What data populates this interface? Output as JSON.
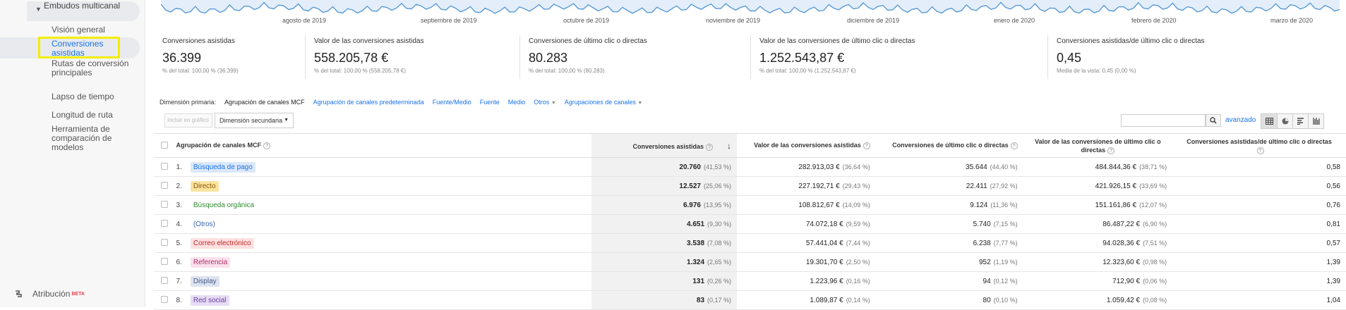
{
  "sidebar": {
    "section_label": "Embudos multicanal",
    "items": [
      {
        "label": "Visión general"
      },
      {
        "label": "Conversiones asistidas"
      },
      {
        "label": "Rutas de conversión principales"
      },
      {
        "label": "Lapso de tiempo"
      },
      {
        "label": "Longitud de ruta"
      },
      {
        "label": "Herramienta de comparación de modelos"
      }
    ],
    "attribution_label": "Atribución",
    "beta_label": "BETA"
  },
  "chart": {
    "months": [
      "agosto de 2019",
      "septiembre de 2019",
      "octubre de 2019",
      "noviembre de 2019",
      "diciembre de 2019",
      "enero de 2020",
      "febrero de 2020",
      "marzo de 2020"
    ],
    "line_color": "#5b9bd5",
    "fill_color": "#e3eefa"
  },
  "summary": [
    {
      "label": "Conversiones asistidas",
      "value": "36.399",
      "sub": "% del total: 100,00 % (36.399)"
    },
    {
      "label": "Valor de las conversiones asistidas",
      "value": "558.205,78 €",
      "sub": "% del total: 100,00 % (558.205,78 €)"
    },
    {
      "label": "Conversiones de último clic o directas",
      "value": "80.283",
      "sub": "% del total: 100,00 % (80.283)"
    },
    {
      "label": "Valor de las conversiones de último clic o directas",
      "value": "1.252.543,87 €",
      "sub": "% del total: 100,00 % (1.252.543,87 €)"
    },
    {
      "label": "Conversiones asistidas/de último clic o directas",
      "value": "0,45",
      "sub": "Media de la vista: 0,45 (0,00 %)"
    }
  ],
  "dimensions": {
    "label": "Dimensión primaria:",
    "active": "Agrupación de canales MCF",
    "links": [
      "Agrupación de canales predeterminada",
      "Fuente/Medio",
      "Fuente",
      "Medio",
      "Otros",
      "Agrupaciones de canales"
    ]
  },
  "toolbar": {
    "plot_label": "Incluir en gráfico",
    "secondary_dimension": "Dimensión secundaria",
    "advanced_label": "avanzado"
  },
  "table": {
    "headers": [
      "Agrupación de canales MCF",
      "Conversiones asistidas",
      "Valor de las conversiones asistidas",
      "Conversiones de último clic o directas",
      "Valor de las conversiones de último clic o directas",
      "Conversiones asistidas/de último clic o directas"
    ],
    "rows": [
      {
        "idx": "1.",
        "channel": "Búsqueda de pago",
        "color": "#1a73e8",
        "bg": "#dce8fb",
        "assisted": "20.760",
        "assisted_pct": "(41,53 %)",
        "assisted_value": "282.913,03 €",
        "assisted_value_pct": "(36,64 %)",
        "last": "35.644",
        "last_pct": "(44,40 %)",
        "last_value": "484.844,36 €",
        "last_value_pct": "(38,71 %)",
        "ratio": "0,58"
      },
      {
        "idx": "2.",
        "channel": "Directo",
        "color": "#8a5a00",
        "bg": "#fbe3a0",
        "assisted": "12.527",
        "assisted_pct": "(25,06 %)",
        "assisted_value": "227.192,71 €",
        "assisted_value_pct": "(29,43 %)",
        "last": "22.411",
        "last_pct": "(27,92 %)",
        "last_value": "421.926,15 €",
        "last_value_pct": "(33,69 %)",
        "ratio": "0,56"
      },
      {
        "idx": "3.",
        "channel": "Búsqueda orgánica",
        "color": "#2e8b2e",
        "bg": "#ffffff",
        "assisted": "6.976",
        "assisted_pct": "(13,95 %)",
        "assisted_value": "108.812,67 €",
        "assisted_value_pct": "(14,09 %)",
        "last": "9.124",
        "last_pct": "(11,36 %)",
        "last_value": "151.161,86 €",
        "last_value_pct": "(12,07 %)",
        "ratio": "0,76"
      },
      {
        "idx": "4.",
        "channel": "(Otros)",
        "color": "#3366aa",
        "bg": "#ffffff",
        "assisted": "4.651",
        "assisted_pct": "(9,30 %)",
        "assisted_value": "74.072,18 €",
        "assisted_value_pct": "(9,59 %)",
        "last": "5.740",
        "last_pct": "(7,15 %)",
        "last_value": "86.487,22 €",
        "last_value_pct": "(6,90 %)",
        "ratio": "0,81"
      },
      {
        "idx": "5.",
        "channel": "Correo electrónico",
        "color": "#c62828",
        "bg": "#fde0e0",
        "assisted": "3.538",
        "assisted_pct": "(7,08 %)",
        "assisted_value": "57.441,04 €",
        "assisted_value_pct": "(7,44 %)",
        "last": "6.238",
        "last_pct": "(7,77 %)",
        "last_value": "94.028,36 €",
        "last_value_pct": "(7,51 %)",
        "ratio": "0,57"
      },
      {
        "idx": "6.",
        "channel": "Referencia",
        "color": "#b0306a",
        "bg": "#fbe0ec",
        "assisted": "1.324",
        "assisted_pct": "(2,65 %)",
        "assisted_value": "19.301,70 €",
        "assisted_value_pct": "(2,50 %)",
        "last": "952",
        "last_pct": "(1,19 %)",
        "last_value": "12.323,60 €",
        "last_value_pct": "(0,98 %)",
        "ratio": "1,39"
      },
      {
        "idx": "7.",
        "channel": "Display",
        "color": "#455a8a",
        "bg": "#dde3ef",
        "assisted": "131",
        "assisted_pct": "(0,26 %)",
        "assisted_value": "1.223,96 €",
        "assisted_value_pct": "(0,16 %)",
        "last": "94",
        "last_pct": "(0,12 %)",
        "last_value": "712,90 €",
        "last_value_pct": "(0,06 %)",
        "ratio": "1,39"
      },
      {
        "idx": "8.",
        "channel": "Red social",
        "color": "#6a3fa0",
        "bg": "#e6dcf5",
        "assisted": "83",
        "assisted_pct": "(0,17 %)",
        "assisted_value": "1.089,87 €",
        "assisted_value_pct": "(0,14 %)",
        "last": "80",
        "last_pct": "(0,10 %)",
        "last_value": "1.059,42 €",
        "last_value_pct": "(0,08 %)",
        "ratio": "1,04"
      }
    ]
  }
}
